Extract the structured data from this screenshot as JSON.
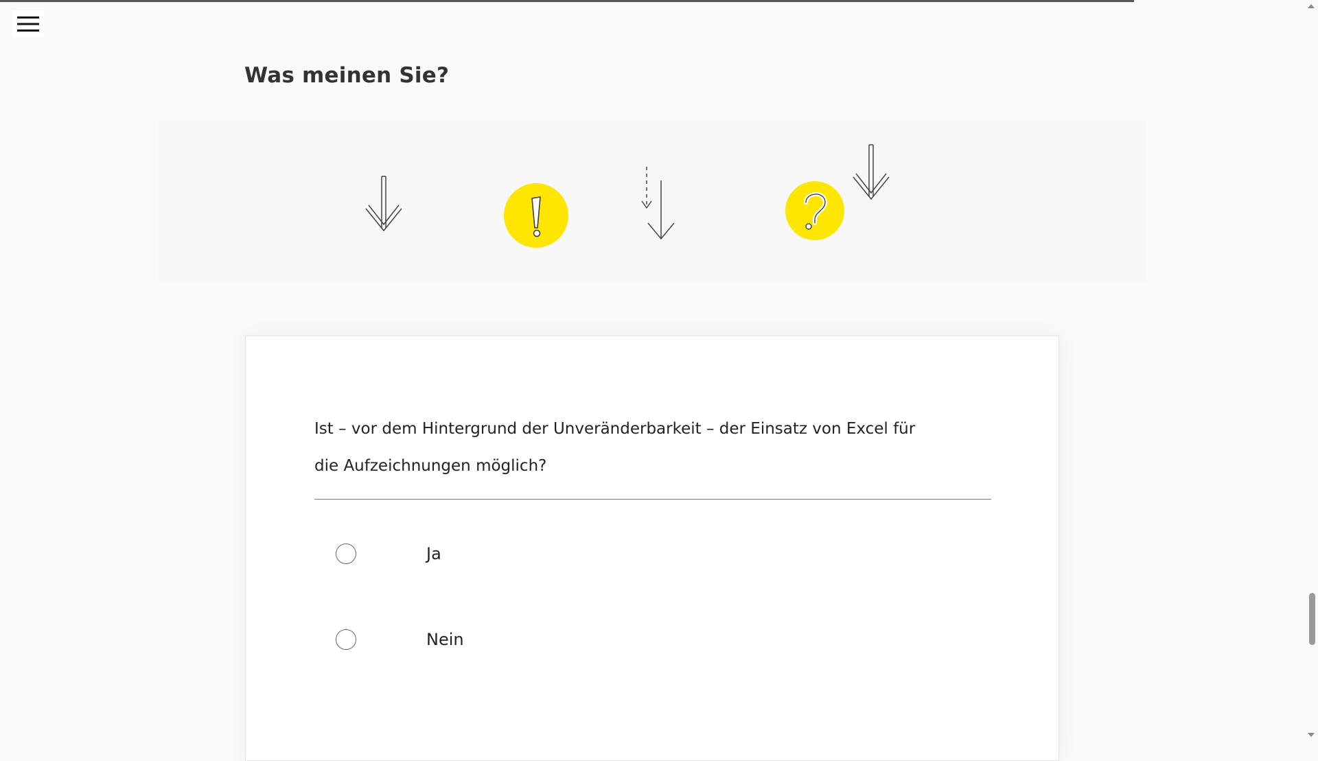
{
  "header": {
    "menu_icon": "hamburger-menu-icon"
  },
  "page": {
    "title": "Was meinen Sie?"
  },
  "illustration": {
    "accent_color": "#ffe600",
    "icons": [
      "arrow-down-icon",
      "exclamation-icon",
      "dashed-arrows-down-icon",
      "question-icon",
      "arrow-down-icon"
    ]
  },
  "quiz": {
    "question": "Ist – vor dem Hintergrund der Unveränderbarkeit – der Einsatz von Excel für die Aufzeichnungen möglich?",
    "options": [
      {
        "label": "Ja",
        "selected": false
      },
      {
        "label": "Nein",
        "selected": false
      }
    ]
  }
}
